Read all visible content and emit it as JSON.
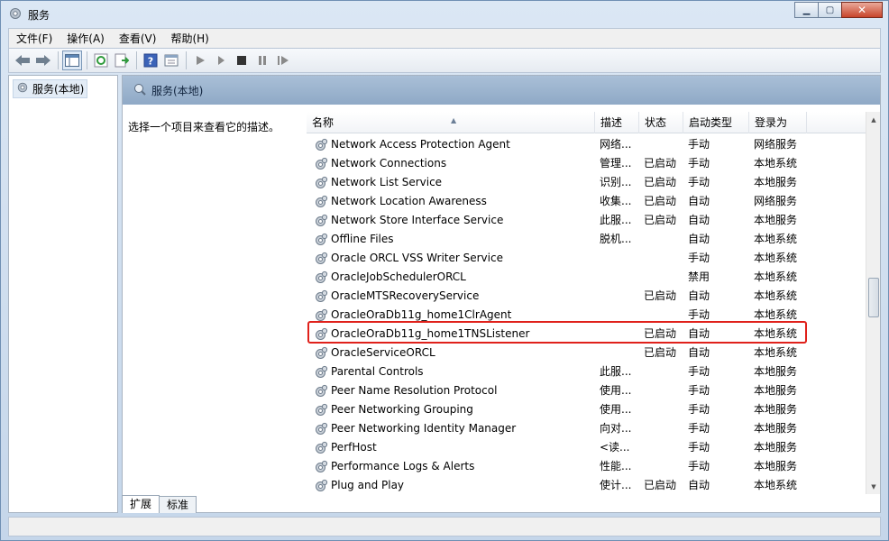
{
  "window": {
    "title": "服务",
    "minimize": "▁",
    "maximize": "▢",
    "close": "✕"
  },
  "menu": [
    "文件(F)",
    "操作(A)",
    "查看(V)",
    "帮助(H)"
  ],
  "tree": {
    "root": "服务(本地)"
  },
  "header": {
    "title": "服务(本地)"
  },
  "description": "选择一个项目来查看它的描述。",
  "columns": {
    "name": "名称",
    "desc": "描述",
    "status": "状态",
    "startup": "启动类型",
    "logon": "登录为"
  },
  "services": [
    {
      "name": "Network Access Protection Agent",
      "desc": "网络...",
      "status": "",
      "startup": "手动",
      "logon": "网络服务"
    },
    {
      "name": "Network Connections",
      "desc": "管理...",
      "status": "已启动",
      "startup": "手动",
      "logon": "本地系统"
    },
    {
      "name": "Network List Service",
      "desc": "识别...",
      "status": "已启动",
      "startup": "手动",
      "logon": "本地服务"
    },
    {
      "name": "Network Location Awareness",
      "desc": "收集...",
      "status": "已启动",
      "startup": "自动",
      "logon": "网络服务"
    },
    {
      "name": "Network Store Interface Service",
      "desc": "此服...",
      "status": "已启动",
      "startup": "自动",
      "logon": "本地服务"
    },
    {
      "name": "Offline Files",
      "desc": "脱机...",
      "status": "",
      "startup": "自动",
      "logon": "本地系统"
    },
    {
      "name": "Oracle ORCL VSS Writer Service",
      "desc": "",
      "status": "",
      "startup": "手动",
      "logon": "本地系统"
    },
    {
      "name": "OracleJobSchedulerORCL",
      "desc": "",
      "status": "",
      "startup": "禁用",
      "logon": "本地系统"
    },
    {
      "name": "OracleMTSRecoveryService",
      "desc": "",
      "status": "已启动",
      "startup": "自动",
      "logon": "本地系统"
    },
    {
      "name": "OracleOraDb11g_home1ClrAgent",
      "desc": "",
      "status": "",
      "startup": "手动",
      "logon": "本地系统"
    },
    {
      "name": "OracleOraDb11g_home1TNSListener",
      "desc": "",
      "status": "已启动",
      "startup": "自动",
      "logon": "本地系统"
    },
    {
      "name": "OracleServiceORCL",
      "desc": "",
      "status": "已启动",
      "startup": "自动",
      "logon": "本地系统"
    },
    {
      "name": "Parental Controls",
      "desc": "此服...",
      "status": "",
      "startup": "手动",
      "logon": "本地服务"
    },
    {
      "name": "Peer Name Resolution Protocol",
      "desc": "使用...",
      "status": "",
      "startup": "手动",
      "logon": "本地服务"
    },
    {
      "name": "Peer Networking Grouping",
      "desc": "使用...",
      "status": "",
      "startup": "手动",
      "logon": "本地服务"
    },
    {
      "name": "Peer Networking Identity Manager",
      "desc": "向对...",
      "status": "",
      "startup": "手动",
      "logon": "本地服务"
    },
    {
      "name": "PerfHost",
      "desc": "<读...",
      "status": "",
      "startup": "手动",
      "logon": "本地服务"
    },
    {
      "name": "Performance Logs & Alerts",
      "desc": "性能...",
      "status": "",
      "startup": "手动",
      "logon": "本地服务"
    },
    {
      "name": "Plug and Play",
      "desc": "使计...",
      "status": "已启动",
      "startup": "自动",
      "logon": "本地系统"
    }
  ],
  "tabs": [
    "扩展",
    "标准"
  ],
  "colors": {
    "highlight": "#e0211b",
    "header_band": "#9fb6d0"
  }
}
